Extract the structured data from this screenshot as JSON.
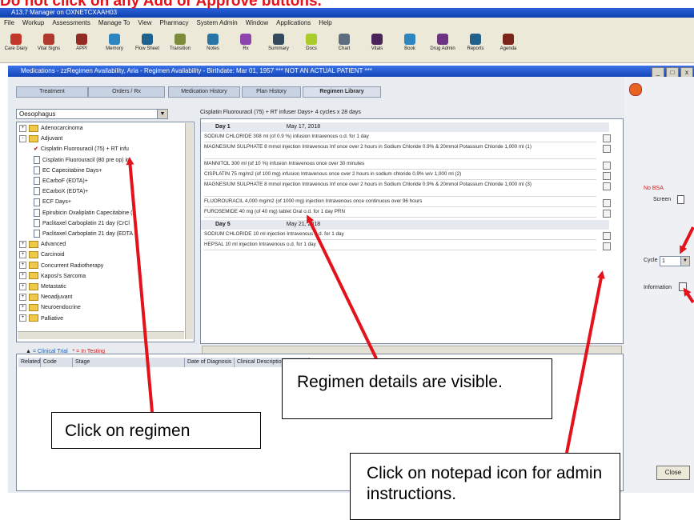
{
  "warning": "Do not click on any Add or Approve buttons.",
  "app_title": "A13.7 Manager on OXNETCXAAH03",
  "menu": [
    "File",
    "Workup",
    "Assessments",
    "Manage To",
    "View",
    "Pharmacy",
    "System Admin",
    "Window",
    "Applications",
    "Help"
  ],
  "toolbar": [
    {
      "label": "Care Diary",
      "icon": "care-diary-icon",
      "color": "#c0392b"
    },
    {
      "label": "Vital Signs",
      "icon": "vital-signs-icon",
      "color": "#b03a2e"
    },
    {
      "label": "APPI",
      "icon": "appi-icon",
      "color": "#922b21"
    },
    {
      "label": "Memory",
      "icon": "memory-icon",
      "color": "#2e86c1"
    },
    {
      "label": "Flow Sheet",
      "icon": "flow-sheet-icon",
      "color": "#1f618d"
    },
    {
      "label": "Transition",
      "icon": "transition-icon",
      "color": "#7d8b3a"
    },
    {
      "label": "Notes",
      "icon": "notes-icon",
      "color": "#2874a6"
    },
    {
      "label": "Rx",
      "icon": "rx-icon",
      "color": "#8e44ad"
    },
    {
      "label": "Summary",
      "icon": "summary-icon",
      "color": "#34495e"
    },
    {
      "label": "Docs",
      "icon": "docs-icon",
      "color": "#a9cc2a"
    },
    {
      "label": "Chart",
      "icon": "chart-icon",
      "color": "#5d6d7e"
    },
    {
      "label": "Vitals",
      "icon": "vitals-icon",
      "color": "#4a235a"
    },
    {
      "label": "Book",
      "icon": "book-icon",
      "color": "#2e86c1"
    },
    {
      "label": "Drug Admin",
      "icon": "drug-admin-icon",
      "color": "#6c3483"
    },
    {
      "label": "Reports",
      "icon": "reports-icon",
      "color": "#21618c"
    },
    {
      "label": "Agenda",
      "icon": "agenda-icon",
      "color": "#7b241c"
    }
  ],
  "window_title": "Medications - zzRegimen Availability, Aria - Regimen Availability - Birthdate: Mar 01, 1957 *** NOT AN ACTUAL PATIENT ***",
  "tabs": [
    "Treatment",
    "Orders / Rx",
    "Medication History",
    "Plan History",
    "Regimen Library"
  ],
  "site_select": "Oesophagus",
  "tree": [
    {
      "type": "folder",
      "exp": "+",
      "label": "Adenocarcinoma",
      "indent": 0
    },
    {
      "type": "folder",
      "exp": "-",
      "label": "Adjuvant",
      "indent": 0
    },
    {
      "type": "check",
      "label": "Cisplatin Fluorouracil (75) + RT infu",
      "indent": 1
    },
    {
      "type": "doc",
      "label": "Cisplatin Fluorouracil (80 pre op) in",
      "indent": 1
    },
    {
      "type": "doc",
      "label": "EC Capecitabine Days+",
      "indent": 1
    },
    {
      "type": "doc",
      "label": "ECarboF (EDTA)+",
      "indent": 1
    },
    {
      "type": "doc",
      "label": "ECarboX (EDTA)+",
      "indent": 1
    },
    {
      "type": "doc",
      "label": "ECF Days+",
      "indent": 1
    },
    {
      "type": "doc",
      "label": "Epirubicin Oxaliplatin Capecitabine (",
      "indent": 1
    },
    {
      "type": "doc",
      "label": "Paclitaxel Carboplatin 21 day (CrCl",
      "indent": 1
    },
    {
      "type": "doc",
      "label": "Paclitaxel Carboplatin 21 day (EDTA",
      "indent": 1
    },
    {
      "type": "folder",
      "exp": "+",
      "label": "Advanced",
      "indent": 0
    },
    {
      "type": "folder",
      "exp": "+",
      "label": "Carcinoid",
      "indent": 0
    },
    {
      "type": "folder",
      "exp": "+",
      "label": "Concurrent Radiotherapy",
      "indent": 0
    },
    {
      "type": "folder",
      "exp": "+",
      "label": "Kaposi's Sarcoma",
      "indent": 0
    },
    {
      "type": "folder",
      "exp": "+",
      "label": "Metastatic",
      "indent": 0
    },
    {
      "type": "folder",
      "exp": "+",
      "label": "Neoadjuvant",
      "indent": 0
    },
    {
      "type": "folder",
      "exp": "+",
      "label": "Neuroendocrine",
      "indent": 0
    },
    {
      "type": "folder",
      "exp": "+",
      "label": "Palliative",
      "indent": 0
    }
  ],
  "legend": {
    "clinical_trial": "= Clinical Trial",
    "in_testing": "* = In Testing"
  },
  "regimen_title": "Cisplatin Fluorouracil (75) + RT infuser Days+ 4 cycles x 28 days",
  "days": [
    {
      "label": "Day 1",
      "date": "May 17, 2018",
      "rows": [
        "SODIUM CHLORIDE 308 ml (of 0.9 %) infusion Intravenous o.d. for 1 day",
        "MAGNESIUM SULPHATE 8 mmol injection Intravenous Inf once over 2 hours in Sodium Chloride 0.9% & 20mmol Potassium Chloride 1,000 ml (1)",
        "MANNITOL 300 ml (of 10 %) infusion Intravenous once over 30 minutes",
        "CISPLATIN 75 mg/m2 (of 100 mg) infusion Intravenous once over 2 hours in sodium chloride 0.9% w/v 1,000 ml (2)",
        "MAGNESIUM SULPHATE 8 mmol injection Intravenous Inf once over 2 hours in Sodium Chloride 0.9% & 20mmol Potassium Chloride 1,000 ml (3)",
        "FLUOROURACIL 4,000 mg/m2 (of 1000 mg) injection Intravenous once continuous over 96 hours",
        "FUROSEMIDE 40 mg (of 40 mg) tablet Oral o.d. for 1 day PRN"
      ]
    },
    {
      "label": "Day 5",
      "date": "May 21, 2018",
      "rows": [
        "SODIUM CHLORIDE 10 ml injection Intravenous o.d. for 1 day",
        "HEPSAL 10 ml injection Intravenous o.d. for 1 day"
      ]
    }
  ],
  "lower_table_headers": [
    "Related",
    "Code",
    "Stage",
    "Date of Diagnosis",
    "Clinical Description"
  ],
  "right_pane": {
    "no_bsa": "No BSA",
    "screen_label": "Screen",
    "cycle_label": "Cycle",
    "cycle_value": "1",
    "information_label": "Information"
  },
  "close_label": "Close",
  "callouts": {
    "regimen": "Click on regimen",
    "details": "Regimen details are visible.",
    "notepad": "Click on notepad icon for admin instructions."
  },
  "colors": {
    "warning": "#e3121b",
    "arrow": "#e3121b",
    "title_bar": "#1446b8"
  }
}
